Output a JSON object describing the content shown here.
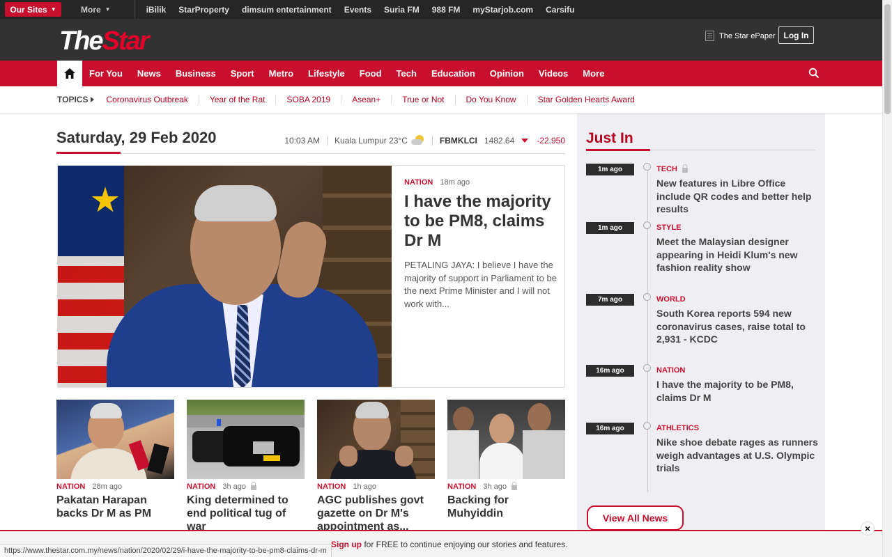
{
  "sites_bar": {
    "our_sites": "Our Sites",
    "more": "More",
    "links": [
      "iBilik",
      "StarProperty",
      "dimsum entertainment",
      "Events",
      "Suria FM",
      "988 FM",
      "myStarjob.com",
      "Carsifu"
    ]
  },
  "masthead": {
    "logo_the": "The",
    "logo_star": "Star",
    "epaper": "The Star ePaper",
    "login": "Log In"
  },
  "nav": {
    "items": [
      "For You",
      "News",
      "Business",
      "Sport",
      "Metro",
      "Lifestyle",
      "Food",
      "Tech",
      "Education",
      "Opinion",
      "Videos",
      "More"
    ]
  },
  "topics": {
    "label": "TOPICS",
    "items": [
      "Coronavirus Outbreak",
      "Year of the Rat",
      "SOBA 2019",
      "Asean+",
      "True or Not",
      "Do You Know",
      "Star Golden Hearts Award"
    ]
  },
  "date_row": {
    "date": "Saturday, 29 Feb 2020",
    "time": "10:03 AM",
    "weather": "Kuala Lumpur 23°C",
    "index_label": "FBMKLCI",
    "index_value": "1482.64",
    "index_change": "-22.950"
  },
  "feature": {
    "category": "NATION",
    "ago": "18m ago",
    "headline": "I have the majority to be PM8, claims Dr M",
    "summary": "PETALING JAYA: I believe I have the majority of support in Parliament to be the next Prime Minister and I will not work with..."
  },
  "cards": [
    {
      "category": "NATION",
      "ago": "28m ago",
      "title": "Pakatan Harapan backs Dr M as PM"
    },
    {
      "category": "NATION",
      "ago": "3h ago",
      "title": "King determined to end political tug of war"
    },
    {
      "category": "NATION",
      "ago": "1h ago",
      "title": "AGC publishes govt gazette on Dr M's appointment as..."
    },
    {
      "category": "NATION",
      "ago": "3h ago",
      "title": "Backing for Muhyiddin"
    }
  ],
  "just_in": {
    "title": "Just In",
    "items": [
      {
        "ago": "1m ago",
        "category": "TECH",
        "title": "New features in Libre Office include QR codes and better help results"
      },
      {
        "ago": "1m ago",
        "category": "STYLE",
        "title": "Meet the Malaysian designer appearing in Heidi Klum's new fashion reality show"
      },
      {
        "ago": "7m ago",
        "category": "WORLD",
        "title": "South Korea reports 594 new coronavirus cases, raise total to 2,931 - KCDC"
      },
      {
        "ago": "16m ago",
        "category": "NATION",
        "title": "I have the majority to be PM8, claims Dr M"
      },
      {
        "ago": "16m ago",
        "category": "ATHLETICS",
        "title": "Nike shoe debate rages as runners weigh advantages at U.S. Olympic trials"
      }
    ],
    "view_all": "View All News"
  },
  "signup": {
    "link": "Sign up",
    "rest": " for FREE to continue enjoying our stories and features.",
    "close": "×"
  },
  "status_url": "https://www.thestar.com.my/news/nation/2020/02/29/i-have-the-majority-to-be-pm8-claims-dr-m",
  "colors": {
    "brand_red": "#c8102e",
    "dark_bar": "#262626",
    "masthead": "#323232"
  }
}
